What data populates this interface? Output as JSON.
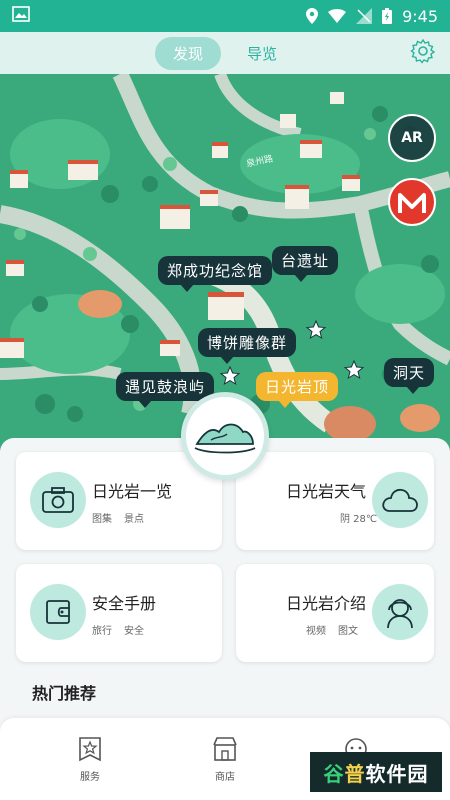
{
  "status_bar": {
    "time": "9:45",
    "icons": [
      "image-icon",
      "location-icon",
      "wifi-icon",
      "signal-icon",
      "battery-icon"
    ]
  },
  "top_tabs": {
    "items": [
      {
        "label": "发现",
        "active": true
      },
      {
        "label": "导览",
        "active": false
      }
    ],
    "settings_icon": "gear-icon"
  },
  "map": {
    "road_label": "泉州路",
    "pois": [
      {
        "label": "郑成功纪念馆",
        "style": "dark"
      },
      {
        "label": "台遗址",
        "style": "dark"
      },
      {
        "label": "博饼雕像群",
        "style": "dark"
      },
      {
        "label": "遇见鼓浪屿",
        "style": "dark"
      },
      {
        "label": "日光岩顶",
        "style": "gold"
      },
      {
        "label": "洞天",
        "style": "dark"
      }
    ],
    "ar_label": "AR",
    "metro_icon": "metro-icon"
  },
  "cards": [
    {
      "title": "日光岩一览",
      "tags": [
        "图集",
        "景点"
      ],
      "icon": "photo-icon"
    },
    {
      "title": "日光岩天气",
      "tags": [
        "阴 28℃"
      ],
      "icon": "cloud-icon"
    },
    {
      "title": "安全手册",
      "tags": [
        "旅行",
        "安全"
      ],
      "icon": "wallet-icon"
    },
    {
      "title": "日光岩介绍",
      "tags": [
        "视频",
        "图文"
      ],
      "icon": "headset-person-icon"
    }
  ],
  "hot_section": {
    "title": "热门推荐"
  },
  "bottom_nav": [
    {
      "label": "服务",
      "icon": "star-bookmark-icon"
    },
    {
      "label": "商店",
      "icon": "shop-icon"
    },
    {
      "label": "",
      "icon": "chat-robot-icon"
    }
  ],
  "watermark": {
    "part1": "谷",
    "part2": "普",
    "part3": "软件园"
  },
  "colors": {
    "primary": "#21b394",
    "map_green": "#3aaa7c",
    "dark_label": "#17343a",
    "gold_label": "#f4b62e",
    "card_icon_bg": "#bde9df",
    "metro_red": "#e2372b"
  }
}
